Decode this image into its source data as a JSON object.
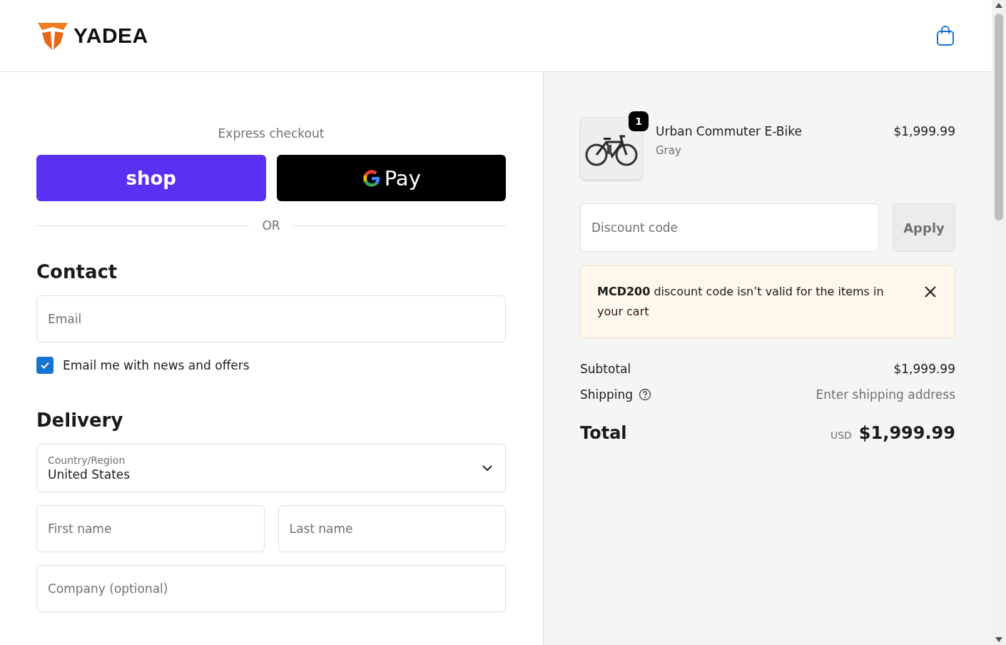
{
  "header": {
    "logo_text": "YADEA"
  },
  "express": {
    "title": "Express checkout",
    "buttons": [
      {
        "kind": "shop",
        "label": "shop"
      },
      {
        "kind": "gpay",
        "label": "Pay"
      }
    ],
    "divider": "OR"
  },
  "contact": {
    "heading": "Contact",
    "email_placeholder": "Email",
    "newsletter": {
      "label": "Email me with news and offers",
      "checked": true
    }
  },
  "delivery": {
    "heading": "Delivery",
    "country": {
      "label": "Country/Region",
      "value": "United States"
    },
    "first_name_placeholder": "First name",
    "last_name_placeholder": "Last name",
    "company_placeholder": "Company (optional)"
  },
  "summary": {
    "item": {
      "name": "Urban Commuter E-Bike",
      "variant": "Gray",
      "price": "$1,999.99",
      "quantity": "1"
    },
    "discount": {
      "placeholder": "Discount code",
      "button": "Apply"
    },
    "error": {
      "message": "**MCD200** discount code isn’t valid for the items in your cart"
    },
    "subtotal": {
      "label": "Subtotal",
      "value": "$1,999.99"
    },
    "shipping": {
      "label": "Shipping",
      "value": "Enter shipping address"
    },
    "total": {
      "label": "Total",
      "currency": "USD",
      "value": "$1,999.99"
    }
  }
}
